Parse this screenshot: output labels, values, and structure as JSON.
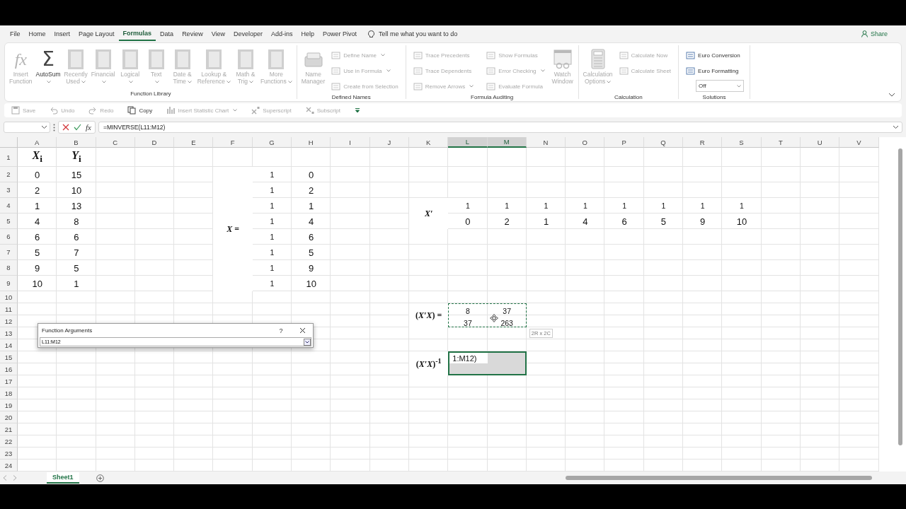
{
  "menu_tabs": [
    {
      "label": "File",
      "selected": false
    },
    {
      "label": "Home",
      "selected": false
    },
    {
      "label": "Insert",
      "selected": false
    },
    {
      "label": "Page Layout",
      "selected": false
    },
    {
      "label": "Formulas",
      "selected": true
    },
    {
      "label": "Data",
      "selected": false
    },
    {
      "label": "Review",
      "selected": false
    },
    {
      "label": "View",
      "selected": false
    },
    {
      "label": "Developer",
      "selected": false
    },
    {
      "label": "Add-ins",
      "selected": false
    },
    {
      "label": "Help",
      "selected": false
    },
    {
      "label": "Power Pivot",
      "selected": false
    }
  ],
  "tell_me": "Tell me what you want to do",
  "share": "Share",
  "ribbon": {
    "groups": [
      {
        "name": "Function Library",
        "items": [
          {
            "kind": "large",
            "glyph": "fx",
            "label": [
              "Insert",
              "Function"
            ],
            "dropdown": false,
            "disabled": true
          },
          {
            "kind": "large",
            "glyph": "Σ",
            "label": [
              "AutoSum"
            ],
            "dropdown": true,
            "disabled": false
          },
          {
            "kind": "large",
            "label": [
              "Recently",
              "Used"
            ],
            "dropdown": true,
            "disabled": true
          },
          {
            "kind": "large",
            "label": [
              "Financial"
            ],
            "dropdown": true,
            "disabled": true
          },
          {
            "kind": "large",
            "label": [
              "Logical"
            ],
            "dropdown": true,
            "disabled": true
          },
          {
            "kind": "large",
            "label": [
              "Text"
            ],
            "dropdown": true,
            "disabled": true
          },
          {
            "kind": "large",
            "label": [
              "Date &",
              "Time"
            ],
            "dropdown": true,
            "disabled": true
          },
          {
            "kind": "large",
            "label": [
              "Lookup &",
              "Reference"
            ],
            "dropdown": true,
            "disabled": true
          },
          {
            "kind": "large",
            "label": [
              "Math &",
              "Trig"
            ],
            "dropdown": true,
            "disabled": true
          },
          {
            "kind": "large",
            "label": [
              "More",
              "Functions"
            ],
            "dropdown": true,
            "disabled": true
          }
        ]
      },
      {
        "name": "Defined Names",
        "items": [
          {
            "kind": "large",
            "label": [
              "Name",
              "Manager"
            ],
            "dropdown": false,
            "disabled": true
          },
          {
            "kind": "small",
            "label": [
              "Define Name"
            ],
            "dropdown": true,
            "disabled": true
          },
          {
            "kind": "small",
            "label": [
              "Use in Formula"
            ],
            "dropdown": true,
            "disabled": true
          },
          {
            "kind": "small",
            "label": [
              "Create from Selection"
            ],
            "dropdown": false,
            "disabled": true
          }
        ]
      },
      {
        "name": "Formula Auditing",
        "items": [
          {
            "kind": "small",
            "label": [
              "Trace Precedents"
            ],
            "dropdown": false,
            "disabled": true
          },
          {
            "kind": "small",
            "label": [
              "Trace Dependents"
            ],
            "dropdown": false,
            "disabled": true
          },
          {
            "kind": "small",
            "label": [
              "Remove Arrows"
            ],
            "dropdown": true,
            "disabled": true
          },
          {
            "kind": "small",
            "label": [
              "Show Formulas"
            ],
            "dropdown": false,
            "disabled": true
          },
          {
            "kind": "small",
            "label": [
              "Error Checking"
            ],
            "dropdown": true,
            "disabled": true
          },
          {
            "kind": "small",
            "label": [
              "Evaluate Formula"
            ],
            "dropdown": false,
            "disabled": true
          },
          {
            "kind": "large",
            "label": [
              "Watch",
              "Window"
            ],
            "dropdown": false,
            "disabled": true
          }
        ]
      },
      {
        "name": "Calculation",
        "items": [
          {
            "kind": "large",
            "label": [
              "Calculation",
              "Options"
            ],
            "dropdown": true,
            "disabled": true
          },
          {
            "kind": "small",
            "label": [
              "Calculate Now"
            ],
            "dropdown": false,
            "disabled": true
          },
          {
            "kind": "small",
            "label": [
              "Calculate Sheet"
            ],
            "dropdown": false,
            "disabled": true
          }
        ]
      },
      {
        "name": "Solutions",
        "items": [
          {
            "kind": "small",
            "label": [
              "Euro Conversion"
            ],
            "dropdown": false,
            "disabled": false
          },
          {
            "kind": "small",
            "label": [
              "Euro Formatting"
            ],
            "dropdown": false,
            "disabled": false
          },
          {
            "kind": "select",
            "label": [
              "Off"
            ],
            "dropdown": true,
            "disabled": false
          }
        ]
      }
    ]
  },
  "quick_toolbar": {
    "items": [
      {
        "label": "Save",
        "dropdown": false,
        "disabled": true
      },
      {
        "label": "Undo",
        "dropdown": false,
        "disabled": true
      },
      {
        "label": "Redo",
        "dropdown": false,
        "disabled": true
      },
      {
        "label": "Copy",
        "dropdown": false,
        "disabled": false
      },
      {
        "label": "Insert Statistic Chart",
        "dropdown": true,
        "disabled": true
      },
      {
        "label": "Superscript",
        "dropdown": false,
        "disabled": true
      },
      {
        "label": "Subscript",
        "dropdown": false,
        "disabled": true
      }
    ]
  },
  "formula_bar": {
    "function_button": "fx",
    "formula": "=MINVERSE(L11:M12)"
  },
  "sheet": {
    "columns": [
      {
        "label": "A",
        "selected": false
      },
      {
        "label": "B",
        "selected": false
      },
      {
        "label": "C",
        "selected": false
      },
      {
        "label": "D",
        "selected": false
      },
      {
        "label": "E",
        "selected": false
      },
      {
        "label": "F",
        "selected": false
      },
      {
        "label": "G",
        "selected": false
      },
      {
        "label": "H",
        "selected": false
      },
      {
        "label": "I",
        "selected": false
      },
      {
        "label": "J",
        "selected": false
      },
      {
        "label": "K",
        "selected": false
      },
      {
        "label": "L",
        "selected": true
      },
      {
        "label": "M",
        "selected": true
      },
      {
        "label": "N",
        "selected": false
      },
      {
        "label": "O",
        "selected": false
      },
      {
        "label": "P",
        "selected": false
      },
      {
        "label": "Q",
        "selected": false
      },
      {
        "label": "R",
        "selected": false
      },
      {
        "label": "S",
        "selected": false
      },
      {
        "label": "T",
        "selected": false
      },
      {
        "label": "U",
        "selected": false
      },
      {
        "label": "V",
        "selected": false
      }
    ],
    "rows": [
      "1",
      "2",
      "3",
      "4",
      "5",
      "6",
      "7",
      "8",
      "9",
      "10",
      "11",
      "12",
      "13",
      "14",
      "15",
      "16",
      "17",
      "18",
      "19",
      "20",
      "21",
      "22",
      "23",
      "24"
    ]
  },
  "data_table": {
    "headers": [
      "*X*$_{i}$",
      "*Y*$_{i}$"
    ],
    "rows": [
      [
        "0",
        "15"
      ],
      [
        "2",
        "10"
      ],
      [
        "1",
        "13"
      ],
      [
        "4",
        "8"
      ],
      [
        "6",
        "6"
      ],
      [
        "5",
        "7"
      ],
      [
        "9",
        "5"
      ],
      [
        "10",
        "1"
      ]
    ]
  },
  "x_matrix": {
    "label": "*X* =",
    "rows": [
      [
        "1",
        "0"
      ],
      [
        "1",
        "2"
      ],
      [
        "1",
        "1"
      ],
      [
        "1",
        "4"
      ],
      [
        "1",
        "6"
      ],
      [
        "1",
        "5"
      ],
      [
        "1",
        "9"
      ],
      [
        "1",
        "10"
      ]
    ]
  },
  "xt_matrix": {
    "label": "X′",
    "rows": [
      [
        "1",
        "1",
        "1",
        "1",
        "1",
        "1",
        "1",
        "1"
      ],
      [
        "0",
        "2",
        "1",
        "4",
        "6",
        "5",
        "9",
        "10"
      ]
    ]
  },
  "xtx_matrix": {
    "label": "(*X′X*) =",
    "referenced": true,
    "rows": [
      [
        "8",
        "37"
      ],
      [
        "37",
        "263"
      ]
    ]
  },
  "inverse_matrix": {
    "label": "(*X′X*)$^{-1}$",
    "selected": true,
    "active_cell": "1:M12)"
  },
  "range_tooltip": "2R x 2C",
  "dialog": {
    "title": "Function Arguments",
    "help": "?",
    "input_value": "L11:M12"
  },
  "sheet_tabs": [
    {
      "label": "Sheet1",
      "selected": true
    }
  ]
}
